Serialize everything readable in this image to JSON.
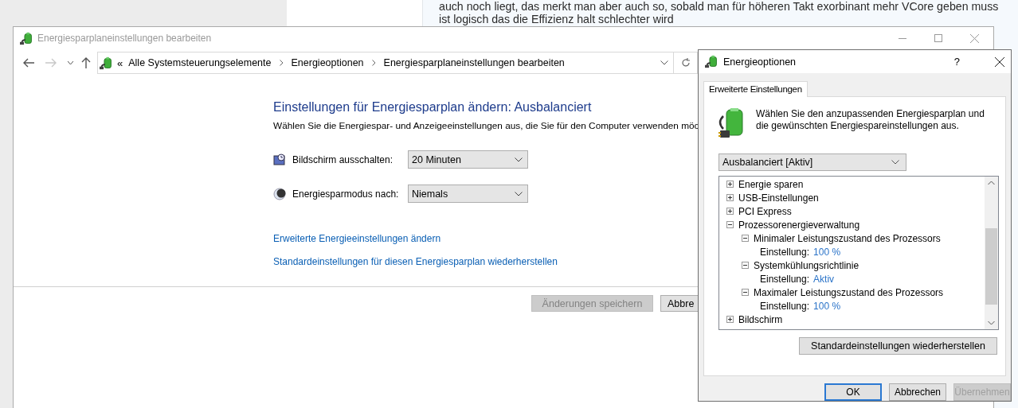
{
  "background_page": {
    "lines": [
      "auch noch liegt, das merkt man aber auch so, sobald man für höheren Takt exorbinant mehr VCore geben muss",
      "ist logisch das die Effizienz halt schlechter wird"
    ]
  },
  "main_window": {
    "title": "Energiesparplaneinstellungen bearbeiten",
    "nav_buttons": [
      {
        "kind": "back",
        "disabled": false
      },
      {
        "kind": "forward",
        "disabled": true
      },
      {
        "kind": "recent",
        "disabled": false
      },
      {
        "kind": "up",
        "disabled": false
      }
    ],
    "address_bar": {
      "overflow": "«",
      "crumbs": [
        "Alle Systemsteuerungselemente",
        "Energieoptionen",
        "Energiesparplaneinstellungen bearbeiten"
      ]
    },
    "heading": "Einstellungen für Energiesparplan ändern: Ausbalanciert",
    "description": "Wählen Sie die Energiespar- und Anzeigeeinstellungen aus, die Sie für den Computer verwenden möc",
    "settings": [
      {
        "kind": "display",
        "label": "Bildschirm ausschalten:",
        "value": "20 Minuten"
      },
      {
        "kind": "sleep",
        "label": "Energiesparmodus nach:",
        "value": "Niemals"
      }
    ],
    "links": [
      "Erweiterte Energieeinstellungen ändern",
      "Standardeinstellungen für diesen Energiesparplan wiederherstellen"
    ],
    "buttons": [
      {
        "label": "Änderungen speichern",
        "disabled": true
      },
      {
        "label": "Abbre",
        "disabled": false
      }
    ]
  },
  "dialog": {
    "title": "Energieoptionen",
    "help": "?",
    "tabs": [
      {
        "label": "Erweiterte Einstellungen",
        "selected": true
      }
    ],
    "intro": "Wählen Sie den anzupassenden Energiesparplan und die gewünschten Energiespareinstellungen aus.",
    "plan": "Ausbalanciert [Aktiv]",
    "tree": [
      {
        "label": "Energie sparen",
        "expanded": false
      },
      {
        "label": "USB-Einstellungen",
        "expanded": false
      },
      {
        "label": "PCI Express",
        "expanded": false
      },
      {
        "label": "Prozessorenergieverwaltung",
        "expanded": true,
        "children": [
          {
            "label": "Minimaler Leistungszustand des Prozessors",
            "expanded": true,
            "children": [
              {
                "kind": "setting",
                "label": "Einstellung:",
                "value": "100 %"
              }
            ]
          },
          {
            "label": "Systemkühlungsrichtlinie",
            "expanded": true,
            "children": [
              {
                "kind": "setting",
                "label": "Einstellung:",
                "value": "Aktiv"
              }
            ]
          },
          {
            "label": "Maximaler Leistungszustand des Prozessors",
            "expanded": true,
            "children": [
              {
                "kind": "setting",
                "label": "Einstellung:",
                "value": "100 %"
              }
            ]
          }
        ]
      },
      {
        "label": "Bildschirm",
        "expanded": false
      }
    ],
    "restore_button": "Standardeinstellungen wiederherstellen",
    "buttons": [
      {
        "label": "OK",
        "default": true,
        "disabled": false
      },
      {
        "label": "Abbrechen",
        "default": false,
        "disabled": false
      },
      {
        "label": "Übernehmen",
        "default": false,
        "disabled": true
      }
    ]
  }
}
